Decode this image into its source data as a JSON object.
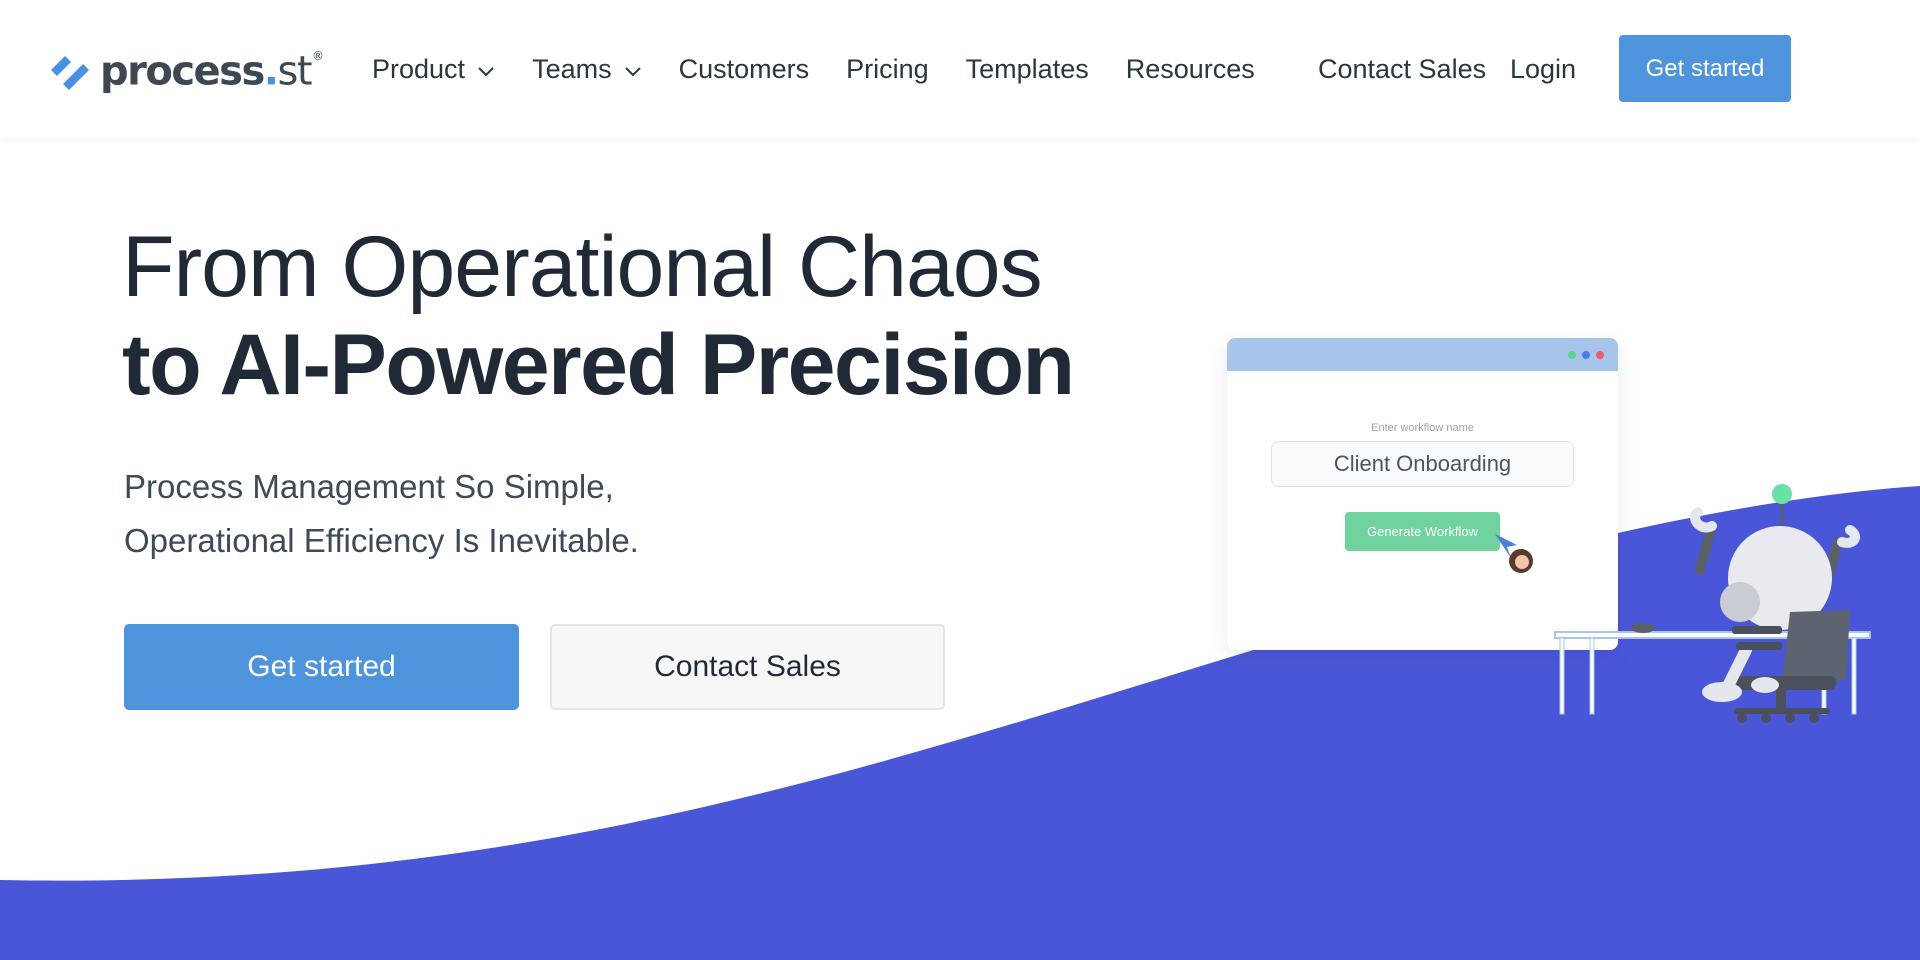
{
  "brand": {
    "name": "process",
    "dot": ".",
    "suffix": "st",
    "registered": "®",
    "accent": "#4a90e2"
  },
  "nav": {
    "items": [
      {
        "label": "Product",
        "has_dropdown": true
      },
      {
        "label": "Teams",
        "has_dropdown": true
      },
      {
        "label": "Customers",
        "has_dropdown": false
      },
      {
        "label": "Pricing",
        "has_dropdown": false
      },
      {
        "label": "Templates",
        "has_dropdown": false
      },
      {
        "label": "Resources",
        "has_dropdown": false
      }
    ],
    "contact_sales": "Contact Sales",
    "login": "Login",
    "cta": "Get started"
  },
  "hero": {
    "title_line1": "From Operational Chaos",
    "title_line2": "to AI-Powered Precision",
    "subtitle_line1": "Process Management So Simple,",
    "subtitle_line2": "Operational Efficiency Is Inevitable.",
    "primary_button": "Get started",
    "secondary_button": "Contact Sales"
  },
  "illustration": {
    "field_label": "Enter workflow name",
    "field_value": "Client Onboarding",
    "button_label": "Generate Workflow",
    "window_dot_colors": [
      "#5fd38d",
      "#4a7fe0",
      "#ef5b6a"
    ]
  },
  "colors": {
    "primary_button": "#4d94dd",
    "wave": "#4a56d8",
    "heading": "#1f2a36",
    "generate_button": "#6fd29f"
  }
}
